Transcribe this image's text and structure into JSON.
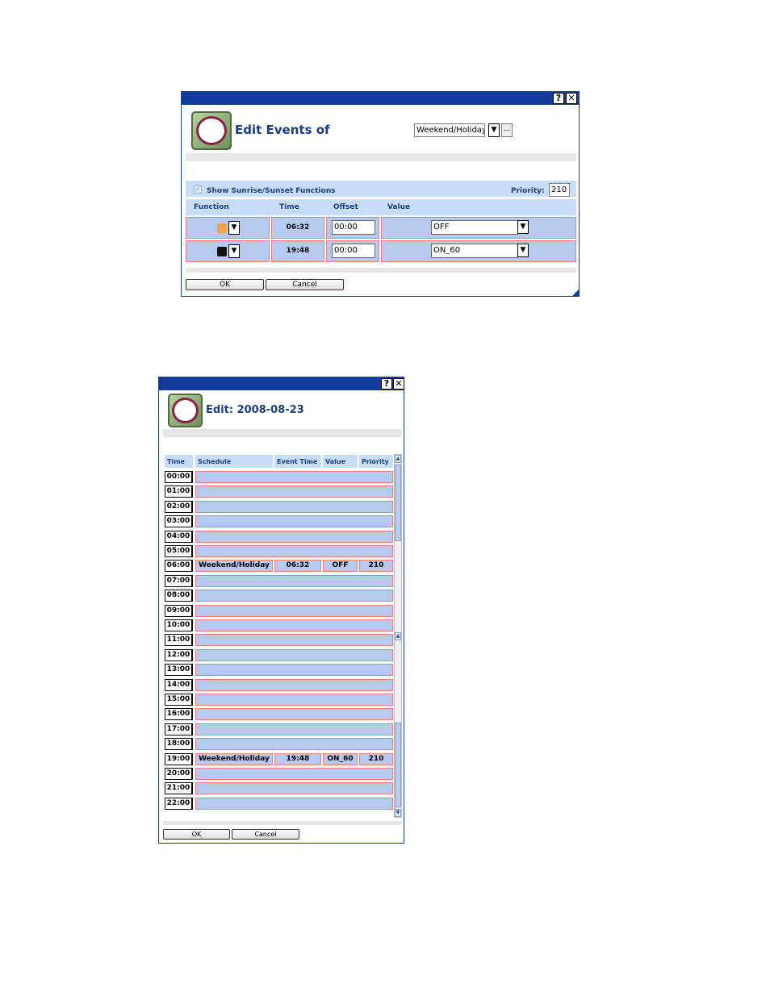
{
  "dialog1": {
    "help_glyph": "?",
    "close_glyph": "✕",
    "title": "Edit Events of",
    "schedule_select": "Weekend/Holiday",
    "dropdown_glyph": "▼",
    "more_glyph": "...",
    "show_functions_label": "Show Sunrise/Sunset Functions",
    "check_glyph": "✓",
    "priority_label": "Priority:",
    "priority_value": "210",
    "columns": {
      "function": "Function",
      "time": "Time",
      "offset": "Offset",
      "value": "Value"
    },
    "rows": [
      {
        "icon": "sunrise-icon",
        "time": "06:32",
        "offset": "00:00",
        "value": "OFF"
      },
      {
        "icon": "moon-icon",
        "time": "19:48",
        "offset": "00:00",
        "value": "ON_60"
      }
    ],
    "ok_label": "OK",
    "cancel_label": "Cancel"
  },
  "dialog2": {
    "help_glyph": "?",
    "close_glyph": "✕",
    "title": "Edit: 2008-08-23",
    "columns": {
      "time": "Time",
      "schedule": "Schedule",
      "event_time": "Event Time",
      "value": "Value",
      "priority": "Priority"
    },
    "hours": [
      "00:00",
      "01:00",
      "02:00",
      "03:00",
      "04:00",
      "05:00",
      "06:00",
      "07:00",
      "08:00",
      "09:00",
      "10:00",
      "11:00",
      "12:00",
      "13:00",
      "14:00",
      "15:00",
      "16:00",
      "17:00",
      "18:00",
      "19:00",
      "20:00",
      "21:00",
      "22:00"
    ],
    "events": [
      {
        "hour": "06:00",
        "schedule": "Weekend/Holiday",
        "event_time": "06:32",
        "value": "OFF",
        "priority": "210"
      },
      {
        "hour": "19:00",
        "schedule": "Weekend/Holiday",
        "event_time": "19:48",
        "value": "ON_60",
        "priority": "210"
      }
    ],
    "scroll_up_glyph": "▲",
    "scroll_down_glyph": "▼",
    "ok_label": "OK",
    "cancel_label": "Cancel"
  }
}
